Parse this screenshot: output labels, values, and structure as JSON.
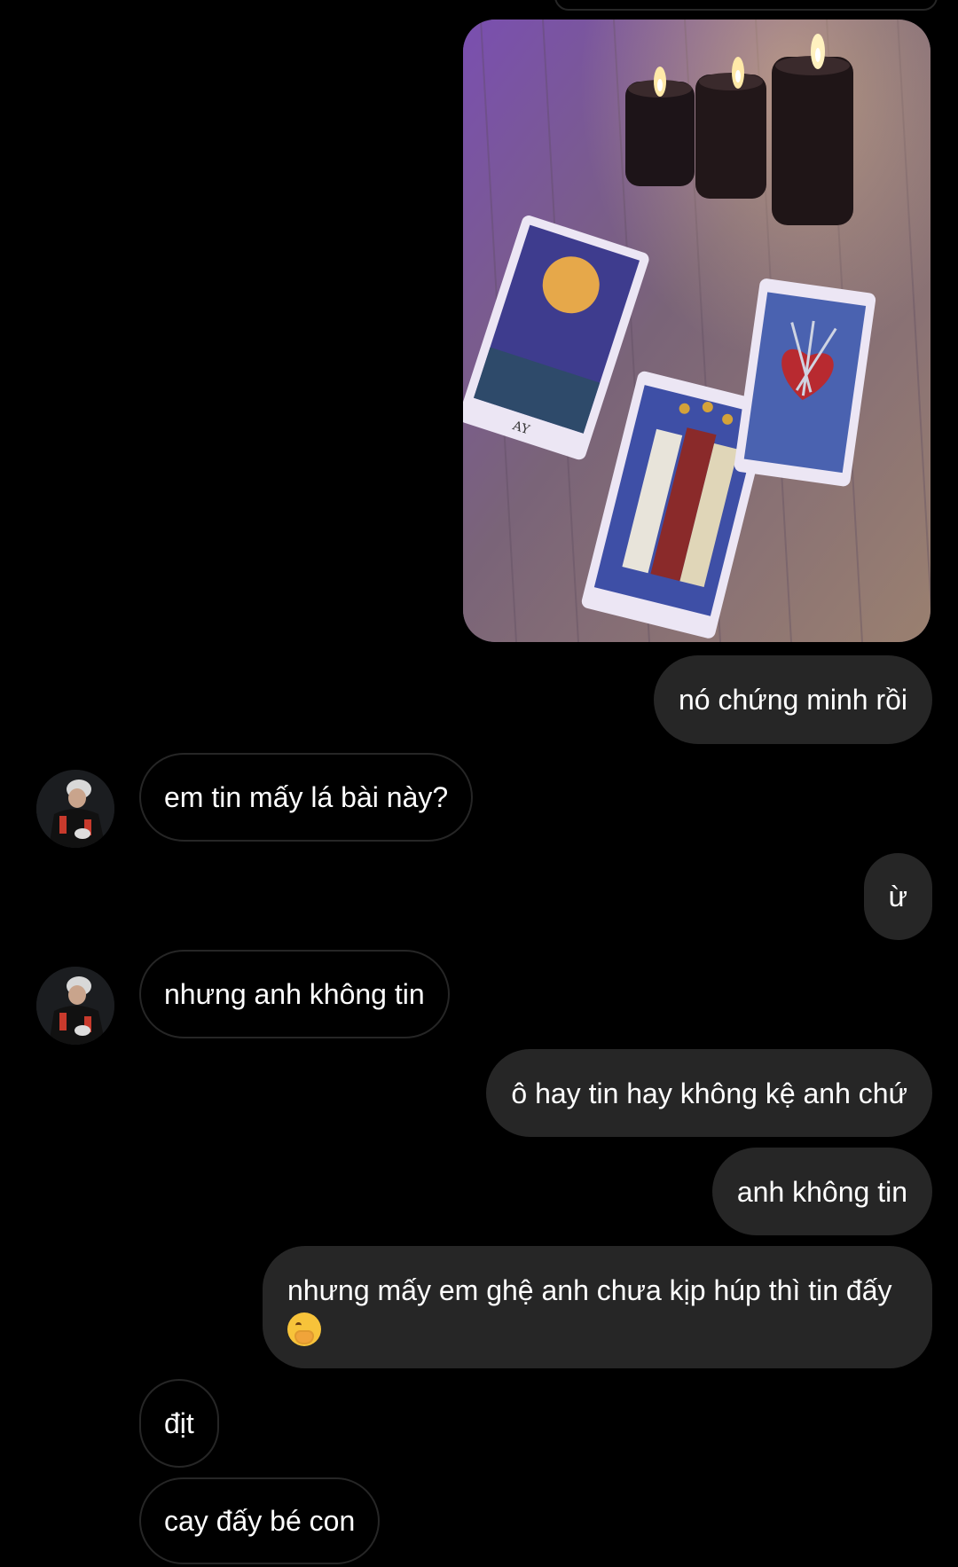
{
  "thread": {
    "photo_icon": "tarot-cards-candles-photo",
    "avatar_icon": "user-avatar",
    "messages": [
      {
        "side": "out",
        "text": "nó chứng minh rồi"
      },
      {
        "side": "in",
        "text": "em tin mấy lá bài này?"
      },
      {
        "side": "out",
        "text": "ừ"
      },
      {
        "side": "in",
        "text": "nhưng anh không tin"
      },
      {
        "side": "out",
        "text": "ô hay tin hay không kệ anh chứ"
      },
      {
        "side": "out",
        "text": "anh không tin"
      },
      {
        "side": "out",
        "text": "nhưng mấy em ghệ anh chưa kịp húp thì tin đấy",
        "emoji": "hand-over-mouth-emoji"
      },
      {
        "side": "in",
        "text": "địt"
      },
      {
        "side": "in",
        "text": "cay đấy bé con"
      }
    ]
  },
  "colors": {
    "background": "#000000",
    "outgoing_bubble": "#262626",
    "incoming_border": "#262626",
    "text": "#ffffff"
  }
}
